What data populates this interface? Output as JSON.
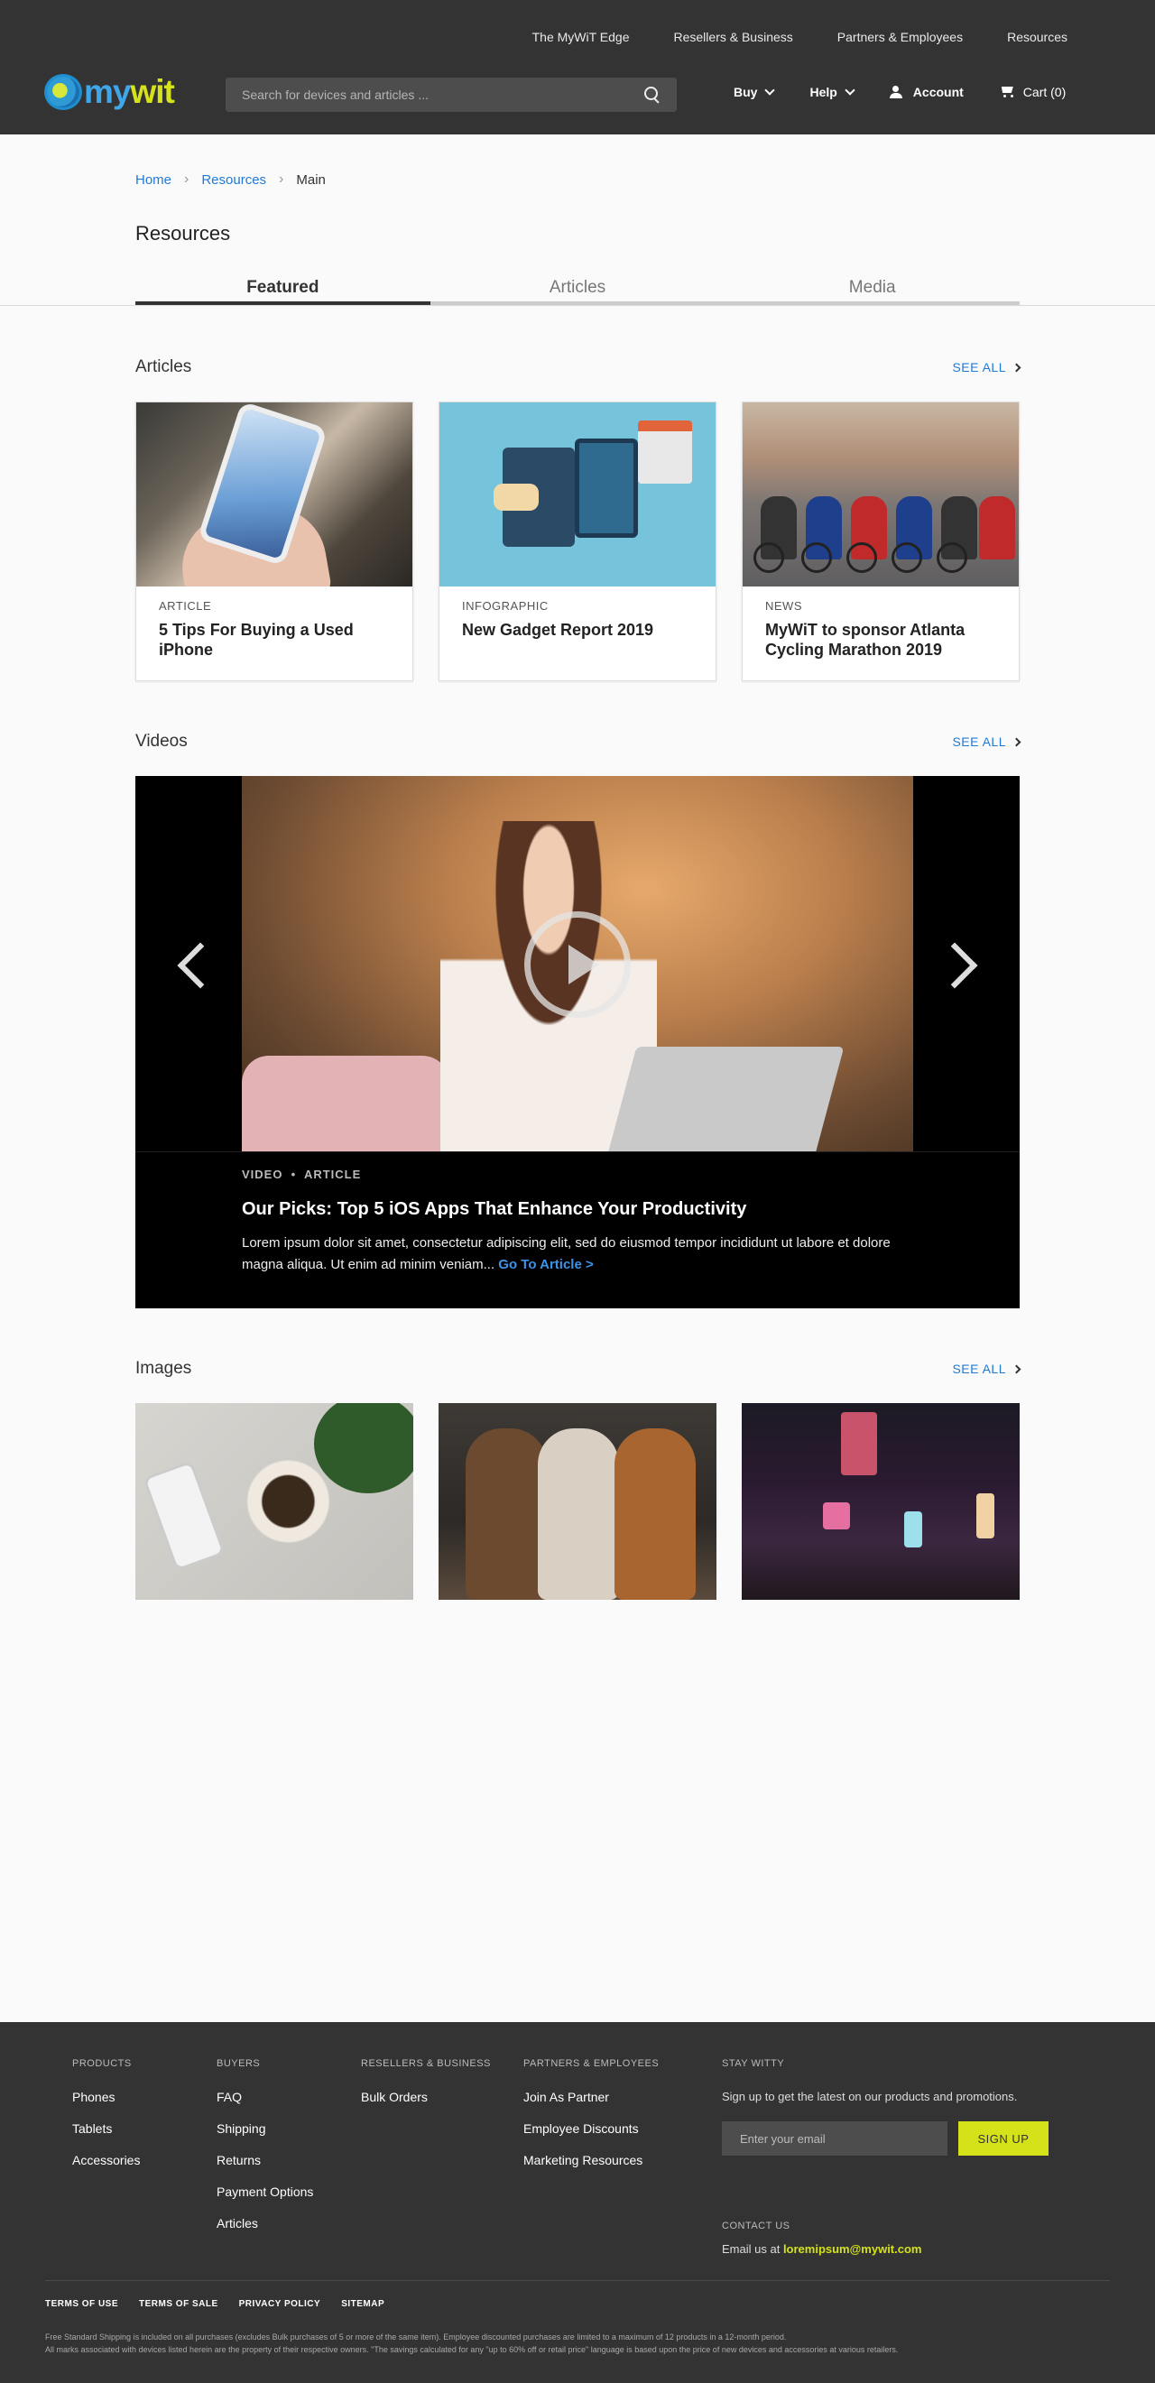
{
  "topnav": [
    "The MyWiT Edge",
    "Resellers & Business",
    "Partners & Employees",
    "Resources"
  ],
  "logo": {
    "part1": "my",
    "part2": "wit"
  },
  "search": {
    "placeholder": "Search for devices and articles ..."
  },
  "mainnav": {
    "buy": "Buy",
    "help": "Help",
    "account": "Account",
    "cart": "Cart (0)"
  },
  "breadcrumb": {
    "home": "Home",
    "resources": "Resources",
    "current": "Main"
  },
  "page_title": "Resources",
  "tabs": [
    {
      "label": "Featured"
    },
    {
      "label": "Articles"
    },
    {
      "label": "Media"
    }
  ],
  "articles": {
    "title": "Articles",
    "see_all": "SEE ALL",
    "cards": [
      {
        "type": "ARTICLE",
        "title": "5 Tips For Buying a Used iPhone"
      },
      {
        "type": "INFOGRAPHIC",
        "title": "New Gadget Report 2019"
      },
      {
        "type": "NEWS",
        "title": "MyWiT to sponsor Atlanta Cycling Marathon 2019"
      }
    ]
  },
  "videos": {
    "title": "Videos",
    "see_all": "SEE ALL",
    "kicker": "VIDEO  •  ARTICLE",
    "feature_title": "Our Picks: Top 5 iOS Apps That Enhance Your Productivity",
    "description": "Lorem ipsum dolor sit amet, consectetur adipiscing elit, sed do eiusmod tempor incididunt ut labore et dolore magna aliqua. Ut enim ad minim veniam...",
    "goto": "Go To Article >"
  },
  "images": {
    "title": "Images",
    "see_all": "SEE ALL"
  },
  "footer": {
    "products": {
      "head": "PRODUCTS",
      "links": [
        "Phones",
        "Tablets",
        "Accessories"
      ]
    },
    "buyers": {
      "head": "BUYERS",
      "links": [
        "FAQ",
        "Shipping",
        "Returns",
        "Payment Options",
        "Articles"
      ]
    },
    "resellers": {
      "head": "RESELLERS & BUSINESS",
      "links": [
        "Bulk Orders"
      ]
    },
    "partners": {
      "head": "PARTNERS & EMPLOYEES",
      "links": [
        "Join As Partner",
        "Employee Discounts",
        "Marketing Resources"
      ]
    },
    "stay": {
      "head": "STAY WITTY",
      "text": "Sign up to get the latest on our products and promotions.",
      "placeholder": "Enter your email",
      "button": "SIGN UP"
    },
    "contact": {
      "head": "CONTACT US",
      "prefix": "Email us at",
      "email": "loremipsum@mywit.com"
    },
    "legal": [
      "TERMS OF USE",
      "TERMS OF SALE",
      "PRIVACY POLICY",
      "SITEMAP"
    ],
    "fine1": "Free Standard Shipping is included on all purchases (excludes Bulk purchases of 5 or more of the same item). Employee discounted purchases are limited to a maximum of 12 products in a 12-month period.",
    "fine2": "All marks associated with devices listed herein are the property of their respective owners. \"The savings calculated for any \"up to 60% off or retail price\" language is based upon the price of new devices and accessories at various retailers."
  },
  "colors": {
    "header_bg": "#333333",
    "link_blue": "#1f7ad6",
    "accent_yellow": "#d5e21a"
  }
}
